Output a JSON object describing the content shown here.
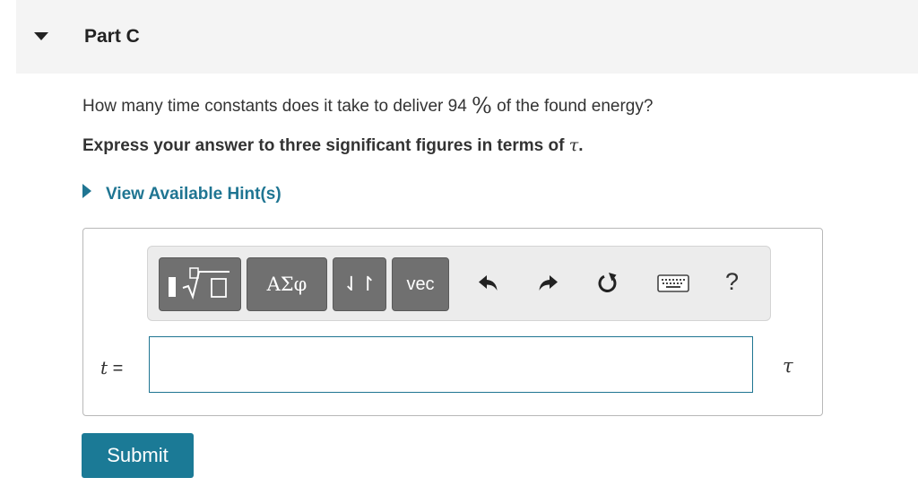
{
  "part": {
    "title": "Part C",
    "expanded": true
  },
  "question": {
    "text_before": "How many time constants does it take to deliver 94 ",
    "percent_symbol": "%",
    "text_after": " of the found energy?",
    "instruction_before": "Express your answer to three significant figures in terms of ",
    "instruction_symbol": "τ",
    "instruction_after": "."
  },
  "hint": {
    "label": "View Available Hint(s)",
    "expanded": false
  },
  "toolbar": {
    "templates_button": "templates-sqrt-icon",
    "greek_label": "ΑΣφ",
    "arrows_label": "⇃↾",
    "vec_label": "vec",
    "undo_icon": "undo-icon",
    "redo_icon": "redo-icon",
    "reset_icon": "reset-icon",
    "keyboard_icon": "keyboard-icon",
    "help_label": "?"
  },
  "answer": {
    "variable": "t",
    "equals": " =",
    "value": "",
    "unit": "τ"
  },
  "submit": {
    "label": "Submit"
  },
  "colors": {
    "accent": "#1f7592",
    "submit_bg": "#1b7a96",
    "toolbar_button": "#707070",
    "header_bg": "#f4f4f4"
  }
}
